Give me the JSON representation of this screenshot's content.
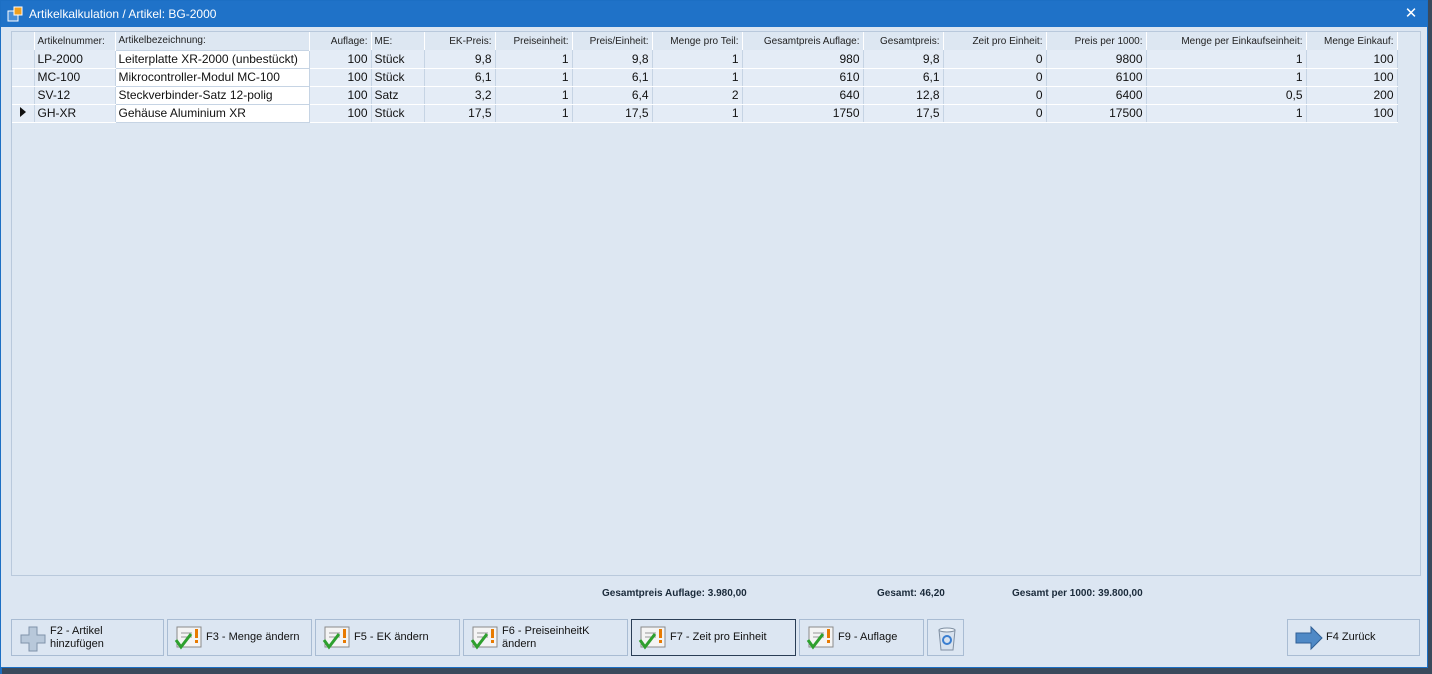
{
  "window": {
    "title": "Artikelkalkulation / Artikel: BG-2000"
  },
  "table": {
    "headers": [
      "Artikelnummer:",
      "Artikelbezeichnung:",
      "Auflage:",
      "ME:",
      "EK-Preis:",
      "Preiseinheit:",
      "Preis/Einheit:",
      "Menge pro Teil:",
      "Gesamtpreis Auflage:",
      "Gesamtpreis:",
      "Zeit pro Einheit:",
      "Preis per 1000:",
      "Menge per Einkaufseinheit:",
      "Menge Einkauf:"
    ],
    "rows": [
      [
        "LP-2000",
        "Leiterplatte XR-2000 (unbestückt)",
        "100",
        "Stück",
        "9,8",
        "1",
        "9,8",
        "1",
        "980",
        "9,8",
        "0",
        "9800",
        "1",
        "100"
      ],
      [
        "MC-100",
        "Mikrocontroller-Modul MC-100",
        "100",
        "Stück",
        "6,1",
        "1",
        "6,1",
        "1",
        "610",
        "6,1",
        "0",
        "6100",
        "1",
        "100"
      ],
      [
        "SV-12",
        "Steckverbinder-Satz 12-polig",
        "100",
        "Satz",
        "3,2",
        "1",
        "6,4",
        "2",
        "640",
        "12,8",
        "0",
        "6400",
        "0,5",
        "200"
      ],
      [
        "GH-XR",
        "Gehäuse Aluminium XR",
        "100",
        "Stück",
        "17,5",
        "1",
        "17,5",
        "1",
        "1750",
        "17,5",
        "0",
        "17500",
        "1",
        "100"
      ]
    ],
    "current_row": 3
  },
  "totals": {
    "gesamtpreis_auflage": "Gesamtpreis Auflage: 3.980,00",
    "gesamt": "Gesamt: 46,20",
    "gesamt_per_1000": "Gesamt per 1000: 39.800,00"
  },
  "buttons": {
    "add_article": "F2 - Artikel\nhinzufügen",
    "change_quantity": "F3 - Menge ändern",
    "change_ek": "F5 - EK ändern",
    "change_price_unit": "F6 - PreiseinheitK\nändern",
    "time_per_unit": "F7 - Zeit pro Einheit",
    "edition": "F9 - Auflage",
    "back": "F4 Zurück"
  },
  "icons": {
    "app": "app-icon",
    "add": "plus-icon",
    "edit": "checklist-icon",
    "delete": "recycle-bin-icon",
    "back": "arrow-right-icon",
    "close": "close-icon"
  }
}
